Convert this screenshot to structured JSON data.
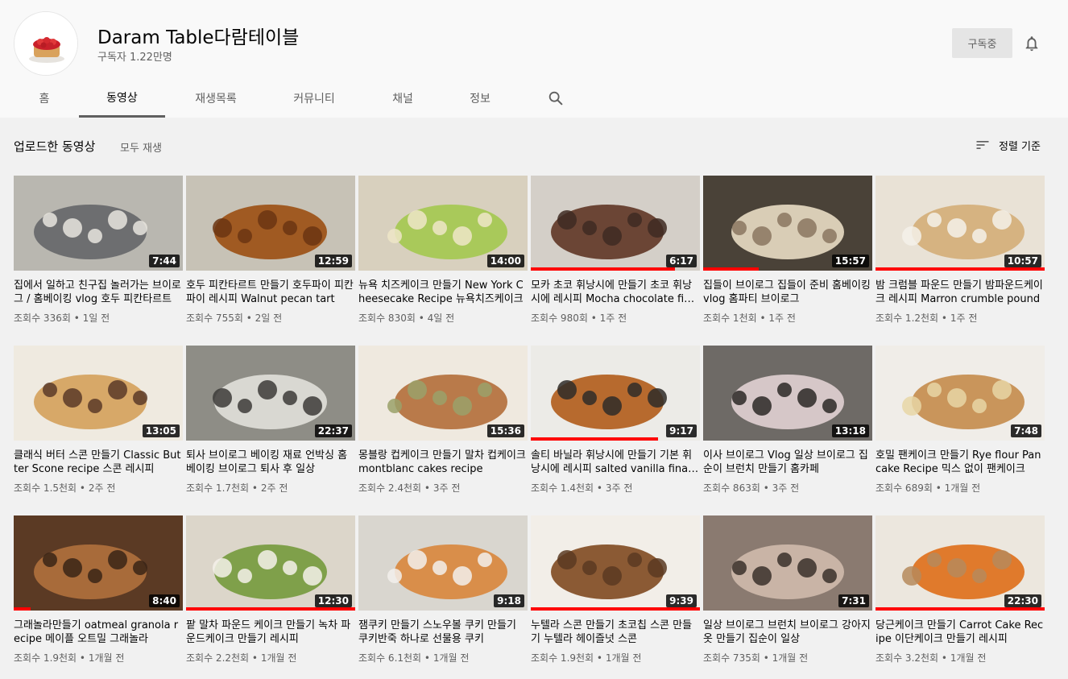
{
  "channel": {
    "title": "Daram Table다람테이블",
    "subscribers": "구독자 1.22만명",
    "subscribe_label": "구독중",
    "avatar_icon": "tart-avatar-icon",
    "bell_icon": "bell-icon"
  },
  "tabs": [
    {
      "label": "홈"
    },
    {
      "label": "동영상"
    },
    {
      "label": "재생목록"
    },
    {
      "label": "커뮤니티"
    },
    {
      "label": "채널"
    },
    {
      "label": "정보"
    }
  ],
  "search_icon": "search-icon",
  "section": {
    "title": "업로드한 동영상",
    "play_all": "모두 재생",
    "sort_label": "정렬 기준",
    "sort_icon": "sort-icon"
  },
  "colors": {
    "progress": "#ff0000",
    "header_bg": "#f9f9f9",
    "page_bg": "#f1f1f1"
  },
  "videos": [
    {
      "title": "집에서 일하고 친구집 놀러가는 브이로그 / 홈베이킹 vlog 호두 피칸타르트",
      "views": "조회수 336회",
      "age": "1일 전",
      "duration": "7:44",
      "progress": 0,
      "palette": [
        "#b9b7b0",
        "#6d6e70",
        "#e8e5de"
      ]
    },
    {
      "title": "호두 피칸타르트 만들기 호두파이 피칸파이 레시피 Walnut pecan tart",
      "views": "조회수 755회",
      "age": "2일 전",
      "duration": "12:59",
      "progress": 0,
      "palette": [
        "#c7c2b6",
        "#a05a22",
        "#6b3512"
      ]
    },
    {
      "title": "뉴욕 치즈케이크 만들기 New York Cheesecake Recipe 뉴욕치즈케이크",
      "views": "조회수 830회",
      "age": "4일 전",
      "duration": "14:00",
      "progress": 0,
      "palette": [
        "#d8d0be",
        "#a9c95a",
        "#efe6c8"
      ]
    },
    {
      "title": "모카 초코 휘낭시에 만들기 초코 휘낭시에 레시피 Mocha chocolate financier",
      "views": "조회수 980회",
      "age": "1주 전",
      "duration": "6:17",
      "progress": 0.85,
      "palette": [
        "#d4cfc8",
        "#6b4535",
        "#3e2a22"
      ]
    },
    {
      "title": "집들이 브이로그 집들이 준비 홈베이킹 vlog 홈파티 브이로그",
      "views": "조회수 1천회",
      "age": "1주 전",
      "duration": "15:57",
      "progress": 0.33,
      "palette": [
        "#4a4238",
        "#d9cdb6",
        "#8a7660"
      ]
    },
    {
      "title": "밤 크럼블 파운드 만들기 밤파운드케이크 레시피 Marron crumble pound",
      "views": "조회수 1.2천회",
      "age": "1주 전",
      "duration": "10:57",
      "progress": 1,
      "palette": [
        "#e9e2d6",
        "#d6b381",
        "#f5f1ea"
      ]
    },
    {
      "title": "클래식 버터 스콘 만들기 Classic Butter Scone recipe 스콘 레시피",
      "views": "조회수 1.5천회",
      "age": "2주 전",
      "duration": "13:05",
      "progress": 0,
      "palette": [
        "#efeae0",
        "#d7a868",
        "#5a3a28"
      ]
    },
    {
      "title": "퇴사 브이로그 베이킹 재료 언박싱 홈베이킹 브이로그 퇴사 후 일상",
      "views": "조회수 1.7천회",
      "age": "2주 전",
      "duration": "22:37",
      "progress": 0,
      "palette": [
        "#8e8d86",
        "#d9d8d2",
        "#3c3b38"
      ]
    },
    {
      "title": "몽블랑 컵케이크 만들기 말차 컵케이크 montblanc cakes recipe",
      "views": "조회수 2.4천회",
      "age": "3주 전",
      "duration": "15:36",
      "progress": 0,
      "palette": [
        "#efe9df",
        "#b97a4a",
        "#9aa16a"
      ]
    },
    {
      "title": "솔티 바닐라 휘낭시에 만들기 기본 휘낭시에 레시피 salted vanilla financier",
      "views": "조회수 1.4천회",
      "age": "3주 전",
      "duration": "9:17",
      "progress": 0.75,
      "palette": [
        "#ecebe7",
        "#b76a2e",
        "#2f2b28"
      ]
    },
    {
      "title": "이사 브이로그 Vlog 일상 브이로그 집순이 브런치 만들기 홈카페",
      "views": "조회수 863회",
      "age": "3주 전",
      "duration": "13:18",
      "progress": 0,
      "palette": [
        "#6e6a66",
        "#d6c7c8",
        "#2b2826"
      ]
    },
    {
      "title": "호밀 팬케이크 만들기 Rye flour Pancake Recipe 믹스 없이 팬케이크",
      "views": "조회수 689회",
      "age": "1개월 전",
      "duration": "7:48",
      "progress": 0,
      "palette": [
        "#f0ede8",
        "#c9955b",
        "#e8d6a6"
      ]
    },
    {
      "title": "그래놀라만들기 oatmeal granola recipe 메이플 오트밀 그래놀라",
      "views": "조회수 1.9천회",
      "age": "1개월 전",
      "duration": "8:40",
      "progress": 0.1,
      "palette": [
        "#5b3a24",
        "#a86b3a",
        "#3a2416"
      ]
    },
    {
      "title": "팥 말차 파운드 케이크 만들기 녹차 파운드케이크 만들기 레시피",
      "views": "조회수 2.2천회",
      "age": "1개월 전",
      "duration": "12:30",
      "progress": 1,
      "palette": [
        "#dcd6ca",
        "#7fa04a",
        "#f4f1ea"
      ]
    },
    {
      "title": "잼쿠키 만들기 스노우볼 쿠키 만들기 쿠키반죽 하나로 선물용 쿠키",
      "views": "조회수 6.1천회",
      "age": "1개월 전",
      "duration": "9:18",
      "progress": 0,
      "palette": [
        "#d9d6cf",
        "#d98e4a",
        "#f2f0ec"
      ]
    },
    {
      "title": "누텔라 스콘 만들기 초코칩 스콘 만들기 누텔라 헤이즐넛 스콘",
      "views": "조회수 1.9천회",
      "age": "1개월 전",
      "duration": "9:39",
      "progress": 1,
      "palette": [
        "#f2eee8",
        "#8b5a34",
        "#5a3a22"
      ]
    },
    {
      "title": "일상 브이로그 브런치 브이로그 강아지옷 만들기 집순이 일상",
      "views": "조회수 735회",
      "age": "1개월 전",
      "duration": "7:31",
      "progress": 0,
      "palette": [
        "#8a7a70",
        "#c9b4a6",
        "#3a302a"
      ]
    },
    {
      "title": "당근케이크 만들기 Carrot Cake Recipe 이단케이크 만들기 레시피",
      "views": "조회수 3.2천회",
      "age": "1개월 전",
      "duration": "22:30",
      "progress": 1,
      "palette": [
        "#ece7de",
        "#e07a2c",
        "#b68a5c"
      ]
    }
  ]
}
